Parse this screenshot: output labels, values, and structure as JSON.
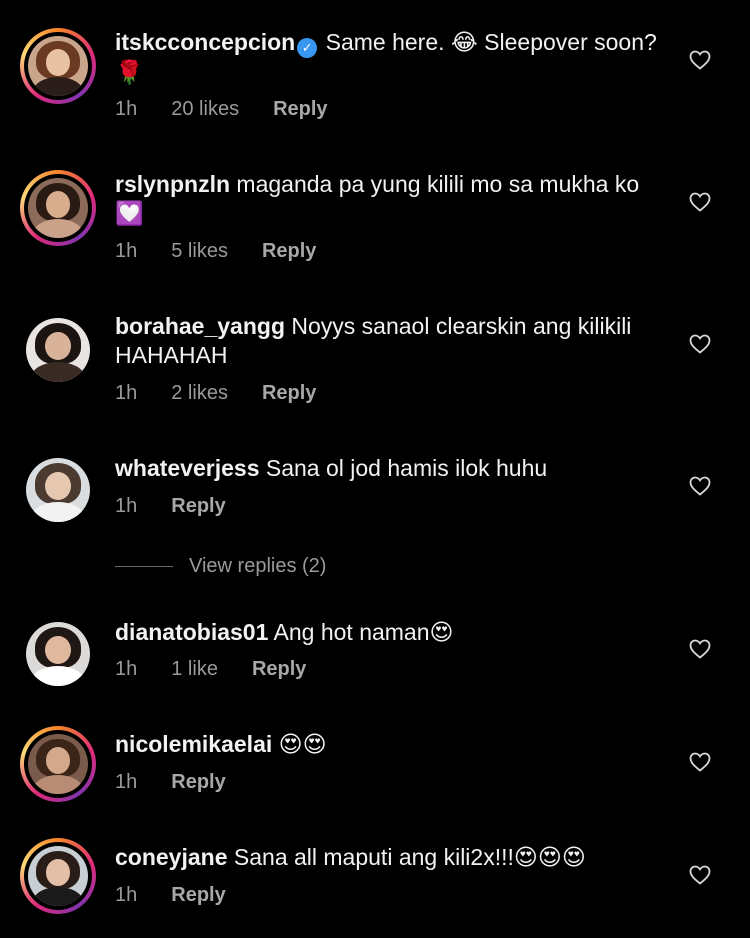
{
  "comments": [
    {
      "username": "itskcconcepcion",
      "verified": true,
      "text": "Same here. 😂 Sleepover soon? 🌹",
      "time": "1h",
      "likes": "20 likes",
      "reply": "Reply",
      "story_ring": true
    },
    {
      "username": "rslynpnzln",
      "verified": false,
      "text": "maganda pa yung kilili mo sa mukha ko 💟",
      "time": "1h",
      "likes": "5 likes",
      "reply": "Reply",
      "story_ring": true
    },
    {
      "username": "borahae_yangg",
      "verified": false,
      "text": "Noyys sanaol clearskin ang kilikili HAHAHAH",
      "time": "1h",
      "likes": "2 likes",
      "reply": "Reply",
      "story_ring": false
    },
    {
      "username": "whateverjess",
      "verified": false,
      "text": "Sana ol jod hamis ilok huhu",
      "time": "1h",
      "likes": "",
      "reply": "Reply",
      "story_ring": false
    },
    {
      "username": "dianatobias01",
      "verified": false,
      "text": "Ang hot naman😍",
      "time": "1h",
      "likes": "1 like",
      "reply": "Reply",
      "story_ring": false
    },
    {
      "username": "nicolemikaelai",
      "verified": false,
      "text": "😍😍",
      "time": "1h",
      "likes": "",
      "reply": "Reply",
      "story_ring": true
    },
    {
      "username": "coneyjane",
      "verified": false,
      "text": "Sana all maputi ang kili2x!!!😍😍😍",
      "time": "1h",
      "likes": "",
      "reply": "Reply",
      "story_ring": true
    }
  ],
  "view_replies": "View replies (2)",
  "icons": {
    "heart": "heart-outline-icon",
    "verified": "verified-badge-icon"
  },
  "colors": {
    "background": "#000000",
    "text": "#f2f2f2",
    "meta": "#9a9a9a",
    "verified": "#3897f0"
  }
}
